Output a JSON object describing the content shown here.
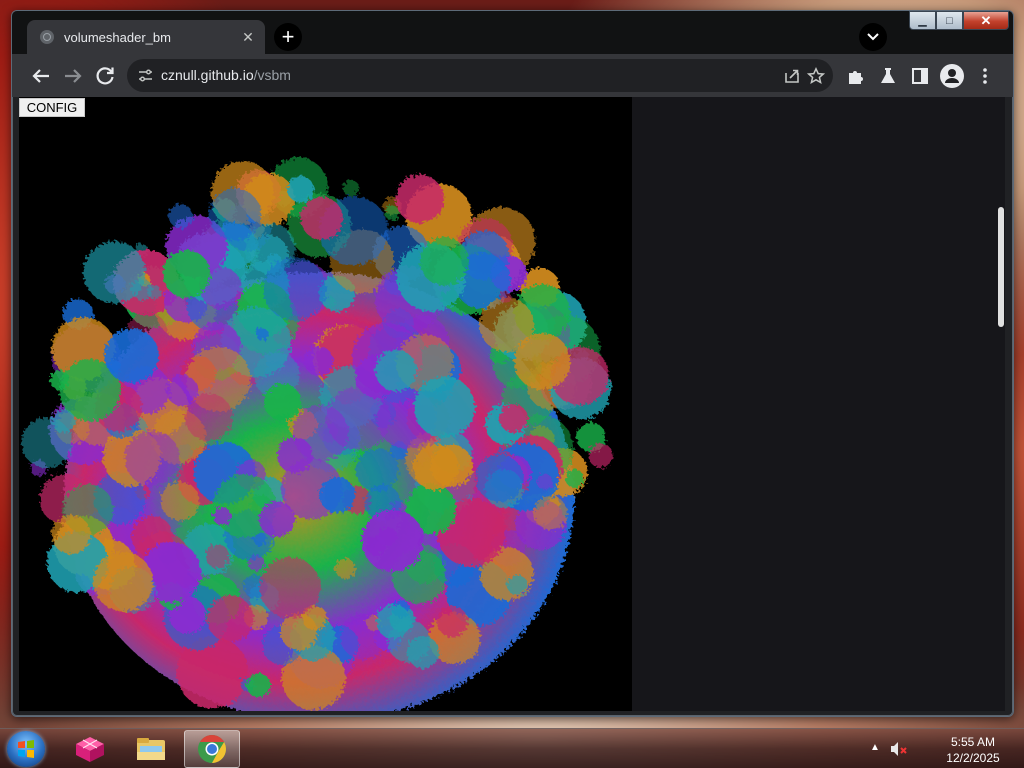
{
  "browser": {
    "tab": {
      "title": "volumeshader_bm",
      "close_label": "✕"
    },
    "new_tab_label": "+",
    "window_buttons": {
      "minimize": "▁",
      "maximize": "□",
      "close": "✕"
    },
    "address": {
      "host": "cznull.github.io",
      "path": "/vsbm"
    }
  },
  "page": {
    "config_button_label": "CONFIG",
    "render_colors": [
      "#1a6bd6",
      "#19b34a",
      "#8a2ad0",
      "#c8286a",
      "#d08a1c",
      "#20a0b0"
    ]
  },
  "taskbar": {
    "apps": [
      {
        "name": "app-cube-icon"
      },
      {
        "name": "file-explorer-icon"
      },
      {
        "name": "chrome-icon",
        "active": true
      }
    ],
    "clock": {
      "time": "5:55 AM",
      "date": "12/2/2025"
    }
  }
}
